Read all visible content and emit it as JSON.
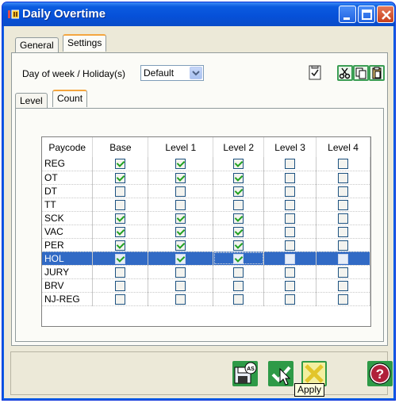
{
  "window": {
    "title": "Daily Overtime"
  },
  "tabs": [
    {
      "label": "General"
    },
    {
      "label": "Settings"
    }
  ],
  "settings": {
    "day_label": "Day of week / Holiday(s)",
    "day_value": "Default"
  },
  "subtabs": [
    {
      "label": "Level"
    },
    {
      "label": "Count"
    }
  ],
  "grid": {
    "columns": [
      "Paycode",
      "Base",
      "Level 1",
      "Level 2",
      "Level 3",
      "Level 4"
    ],
    "rows": [
      {
        "code": "REG",
        "checks": [
          true,
          true,
          true,
          false,
          false
        ]
      },
      {
        "code": "OT",
        "checks": [
          true,
          true,
          true,
          false,
          false
        ]
      },
      {
        "code": "DT",
        "checks": [
          false,
          false,
          true,
          false,
          false
        ]
      },
      {
        "code": "TT",
        "checks": [
          false,
          false,
          false,
          false,
          false
        ]
      },
      {
        "code": "SCK",
        "checks": [
          true,
          true,
          true,
          false,
          false
        ]
      },
      {
        "code": "VAC",
        "checks": [
          true,
          true,
          true,
          false,
          false
        ]
      },
      {
        "code": "PER",
        "checks": [
          true,
          true,
          true,
          false,
          false
        ]
      },
      {
        "code": "HOL",
        "checks": [
          true,
          true,
          true,
          false,
          false
        ],
        "selected": true
      },
      {
        "code": "JURY",
        "checks": [
          false,
          false,
          false,
          false,
          false
        ]
      },
      {
        "code": "BRV",
        "checks": [
          false,
          false,
          false,
          false,
          false
        ]
      },
      {
        "code": "NJ-REG",
        "checks": [
          false,
          false,
          false,
          false,
          false
        ]
      }
    ]
  },
  "tooltip": {
    "text": "Apply"
  },
  "icons": {
    "app": "app-icon",
    "toolbar": [
      "checklist-icon",
      "scissors-icon",
      "copy-icon",
      "paste-icon"
    ],
    "bottom": [
      "save-as-icon",
      "apply-icon",
      "cancel-icon",
      "help-icon"
    ]
  },
  "colors": {
    "titlebar": "#0650d8",
    "selection": "#316ac5",
    "check": "#21a121",
    "tab_accent": "#f4a640"
  }
}
